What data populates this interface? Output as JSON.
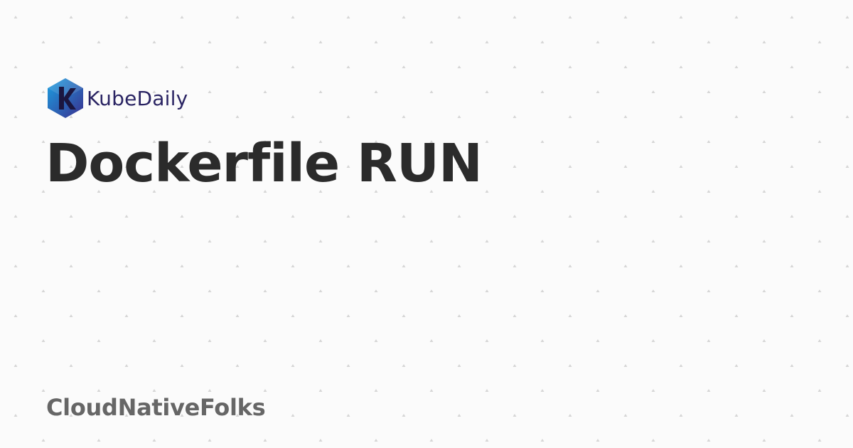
{
  "brand": {
    "logo_text": "KubeDaily",
    "logo_icon": "kubedaily-k-hexagon-icon",
    "logo_color": "#2a2463",
    "logo_gradient": [
      "#1ba1e2",
      "#3a2f8f"
    ]
  },
  "article": {
    "title": "Dockerfile RUN"
  },
  "footer": {
    "author": "CloudNativeFolks"
  },
  "background": {
    "color": "#fbfbfb",
    "pattern_icon": "small-triangle-dot-pattern",
    "pattern_color": "#d6d6d6"
  }
}
